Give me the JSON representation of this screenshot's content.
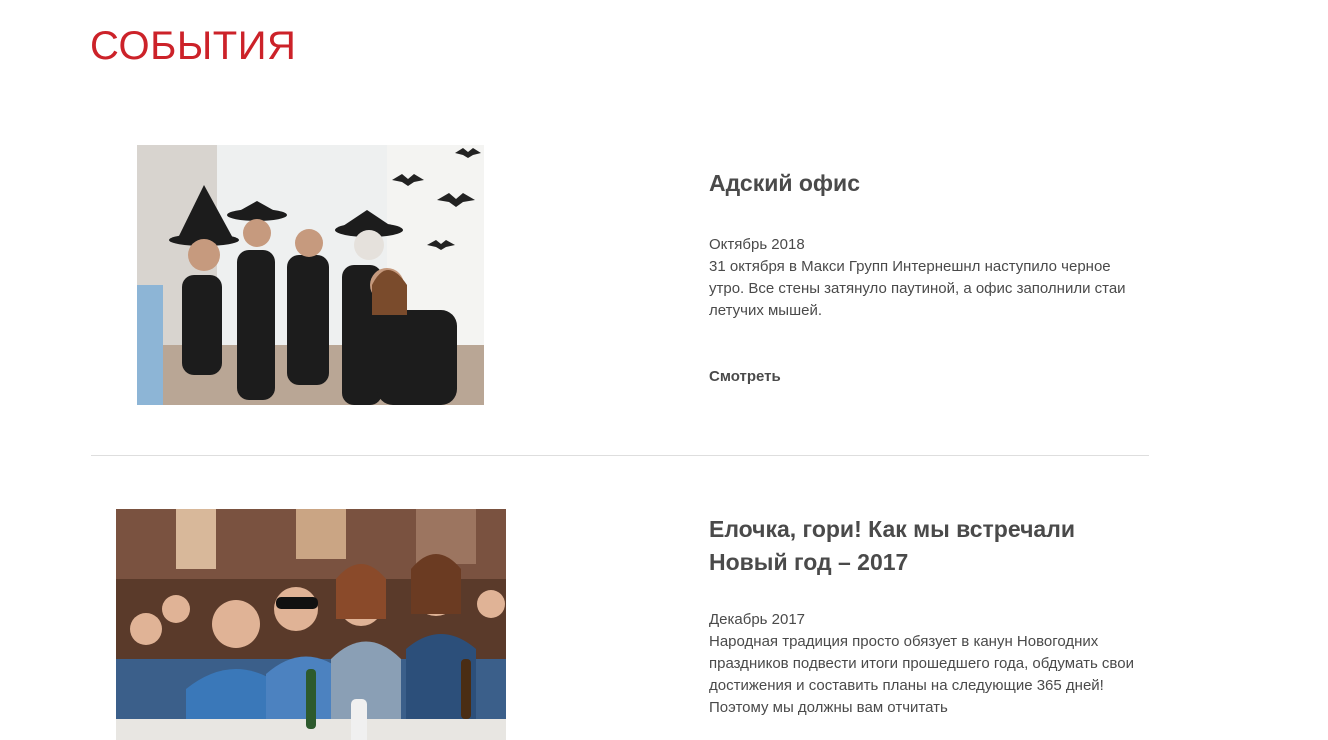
{
  "page": {
    "title": "СОБЫТИЯ"
  },
  "events": [
    {
      "title": "Адский офис",
      "date": "Октябрь 2018",
      "description": "31 октября в Макси Групп Интернешнл наступило черное утро. Все стены затянуло паутиной, а офис заполнили стаи летучих мышей.",
      "link_label": "Смотреть",
      "photo_alt": "Halloween office party photo"
    },
    {
      "title": "Елочка, гори! Как мы встречали Новый год – 2017",
      "date": "Декабрь 2017",
      "description": "Народная традиция просто обязует в канун Новогодних праздников подвести итоги прошедшего года, обдумать свои достижения и составить планы на следующие 365 дней! Поэтому мы должны вам отчитать",
      "photo_alt": "New Year party photo"
    }
  ]
}
